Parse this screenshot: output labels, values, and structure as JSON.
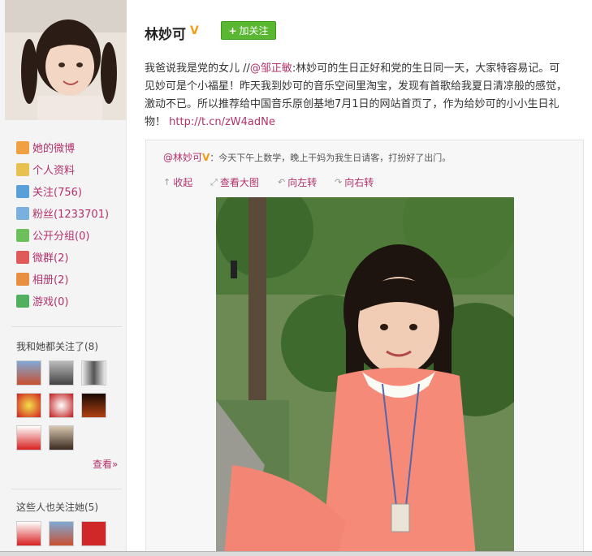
{
  "profile": {
    "name": "林妙可",
    "verified_badge": "V",
    "follow_button": "加关注"
  },
  "sidebar": {
    "nav": [
      {
        "label": "她的微博",
        "icon": "home-icon"
      },
      {
        "label": "个人资料",
        "icon": "profile-card-icon"
      },
      {
        "label": "关注(756)",
        "icon": "follow-icon"
      },
      {
        "label": "粉丝(1233701)",
        "icon": "fans-icon"
      },
      {
        "label": "公开分组(0)",
        "icon": "group-icon"
      },
      {
        "label": "微群(2)",
        "icon": "microgroup-icon"
      },
      {
        "label": "相册(2)",
        "icon": "album-icon"
      },
      {
        "label": "游戏(0)",
        "icon": "game-icon"
      }
    ],
    "mutual_title": "我和她都关注了(8)",
    "more_link": "查看»",
    "followers_title": "这些人也关注她(5)"
  },
  "post": {
    "text_before": "我爸说我是党的女儿 //",
    "mention": "@邹正敏",
    "text_after": ":林妙可的生日正好和党的生日同一天，大家特容易记。可见妙可是个小福星！昨天我到妙可的音乐空间里淘宝，发现有首歌给我夏日清凉般的感觉，激动不已。所以推荐给中国音乐原创基地7月1日的网站首页了，作为给妙可的小小生日礼物！",
    "link": "http://t.cn/zW4adNe"
  },
  "quote": {
    "author": "@林妙可",
    "author_badge": "V",
    "text": "：今天下午上数学，晚上干妈为我生日请客，打扮好了出门。",
    "tools": {
      "collapse": "收起",
      "view_large": "查看大图",
      "rotate_left": "向左转",
      "rotate_right": "向右转"
    }
  },
  "colors": {
    "link": "#b3316a",
    "follow_green": "#5ab732",
    "verified_orange": "#f29d15"
  }
}
